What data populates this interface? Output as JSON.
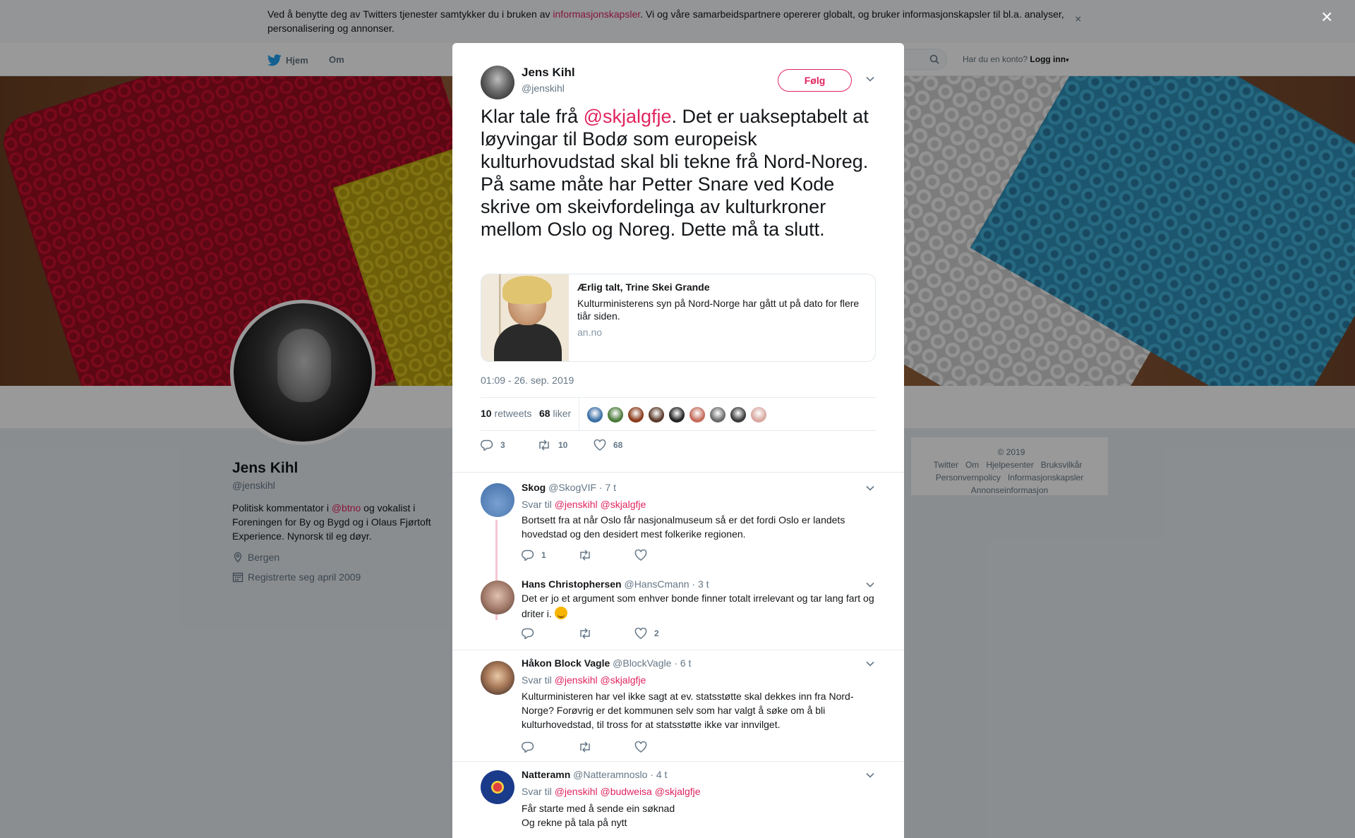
{
  "cookie_bar": {
    "text_before": "Ved å benytte deg av Twitters tjenester samtykker du i bruken av ",
    "link": "informasjonskapsler",
    "text_after": ". Vi og våre samarbeidspartnere opererer globalt, og bruker informasjonskapsler til bl.a. analyser, personalisering og annonser.",
    "close": "×"
  },
  "nav": {
    "home": "Hjem",
    "about": "Om",
    "have_account": "Har du en konto?",
    "login": "Logg inn"
  },
  "profile": {
    "name": "Jens Kihl",
    "handle": "@jenskihl",
    "bio_before": "Politisk kommentator i ",
    "bio_link": "@btno",
    "bio_after": " og vokalist i Foreningen for By og Bygd og i Olaus Fjørtoft Experience. Nynorsk til eg døyr.",
    "location": "Bergen",
    "joined": "Registrerte seg april 2009"
  },
  "footer": {
    "copyright": "© 2019 Twitter",
    "about": "Om",
    "help": "Hjelpesenter",
    "terms": "Bruksvilkår",
    "privacy": "Personvernpolicy",
    "cookies": "Informasjonskapsler",
    "ads": "Annonseinformasjon"
  },
  "overlay_close": "×",
  "tweet": {
    "author_name": "Jens Kihl",
    "author_handle": "@jenskihl",
    "follow_label": "Følg",
    "text_before": "Klar tale frå ",
    "text_mention": "@skjalgfje",
    "text_after": ". Det er uakseptabelt at løyvingar til Bodø som europeisk kulturhovudstad skal bli tekne frå Nord-Noreg. På same måte har Petter Snare ved Kode skrive om skeivfordelinga av kulturkroner mellom Oslo og Noreg. Dette må ta slutt.",
    "card": {
      "title": "Ærlig talt, Trine Skei Grande",
      "description": "Kulturministerens syn på Nord-Norge har gått ut på dato for flere tiår siden.",
      "domain": "an.no"
    },
    "timestamp": "01:09 - 26. sep. 2019",
    "retweets_count": "10",
    "retweets_label": "retweets",
    "likes_count": "68",
    "likes_label": "liker",
    "liker_colors": [
      "#3b6ea5",
      "#4a7a3a",
      "#8a3a1a",
      "#5a3a2a",
      "#222222",
      "#c46a5a",
      "#6a6a6a",
      "#3a3a3a",
      "#d8a8a0"
    ],
    "actions": {
      "replies": "3",
      "retweets": "10",
      "likes": "68"
    }
  },
  "replies": [
    {
      "name": "Skog",
      "handle": "@SkogVIF",
      "time": "· 7 t",
      "reply_to_label": "Svar til",
      "reply_to": [
        "@jenskihl",
        "@skjalgfje"
      ],
      "text": "Bortsett fra at når Oslo får nasjonalmuseum så er det fordi Oslo er landets hovedstad og den desidert mest folkerike regionen.",
      "counts": {
        "replies": "1",
        "retweets": "",
        "likes": ""
      },
      "avatar_color": "#5a8ac0"
    },
    {
      "name": "Hans Christophersen",
      "handle": "@HansCmann",
      "time": "· 3 t",
      "text": "Det er jo et argument som enhver bonde finner totalt irrelevant og tar lang fart og driter i.",
      "counts": {
        "replies": "",
        "retweets": "",
        "likes": "2"
      },
      "avatar_color": "#a08070"
    },
    {
      "name": "Håkon Block Vagle",
      "handle": "@BlockVagle",
      "time": "· 6 t",
      "reply_to_label": "Svar til",
      "reply_to": [
        "@jenskihl",
        "@skjalgfje"
      ],
      "text": "Kulturministeren har vel ikke sagt at ev. statsstøtte skal dekkes inn fra Nord-Norge? Forøvrig er det kommunen selv som har valgt å søke om å bli kulturhovedstad, til tross for at statsstøtte ikke var innvilget.",
      "counts": {
        "replies": "",
        "retweets": "",
        "likes": ""
      },
      "avatar_color": "#5a4a3a"
    },
    {
      "name": "Natteramn",
      "handle": "@Natteramnoslo",
      "time": "· 4 t",
      "reply_to_label": "Svar til",
      "reply_to": [
        "@jenskihl",
        "@budweisa",
        "@skjalgfje"
      ],
      "text_line1": "Får starte med å sende ein søknad",
      "text_line2": "Og rekne på tala på nytt",
      "avatar_color": "#1a3a8a"
    }
  ]
}
